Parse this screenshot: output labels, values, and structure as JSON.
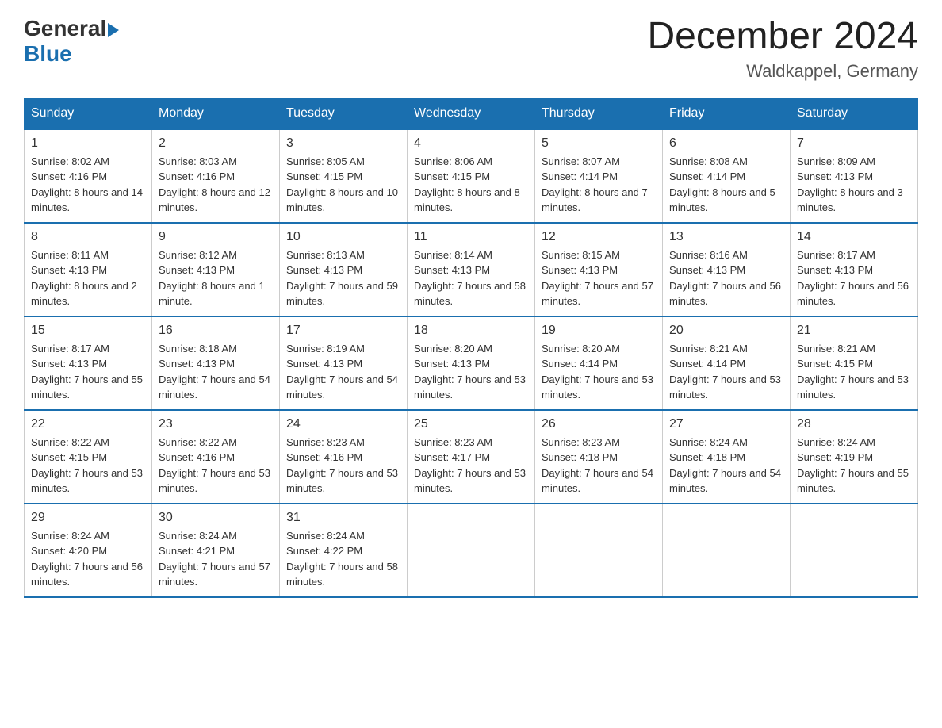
{
  "logo": {
    "general": "General",
    "blue": "Blue"
  },
  "header": {
    "month_title": "December 2024",
    "location": "Waldkappel, Germany"
  },
  "columns": [
    "Sunday",
    "Monday",
    "Tuesday",
    "Wednesday",
    "Thursday",
    "Friday",
    "Saturday"
  ],
  "weeks": [
    [
      {
        "day": "1",
        "sunrise": "8:02 AM",
        "sunset": "4:16 PM",
        "daylight": "8 hours and 14 minutes."
      },
      {
        "day": "2",
        "sunrise": "8:03 AM",
        "sunset": "4:16 PM",
        "daylight": "8 hours and 12 minutes."
      },
      {
        "day": "3",
        "sunrise": "8:05 AM",
        "sunset": "4:15 PM",
        "daylight": "8 hours and 10 minutes."
      },
      {
        "day": "4",
        "sunrise": "8:06 AM",
        "sunset": "4:15 PM",
        "daylight": "8 hours and 8 minutes."
      },
      {
        "day": "5",
        "sunrise": "8:07 AM",
        "sunset": "4:14 PM",
        "daylight": "8 hours and 7 minutes."
      },
      {
        "day": "6",
        "sunrise": "8:08 AM",
        "sunset": "4:14 PM",
        "daylight": "8 hours and 5 minutes."
      },
      {
        "day": "7",
        "sunrise": "8:09 AM",
        "sunset": "4:13 PM",
        "daylight": "8 hours and 3 minutes."
      }
    ],
    [
      {
        "day": "8",
        "sunrise": "8:11 AM",
        "sunset": "4:13 PM",
        "daylight": "8 hours and 2 minutes."
      },
      {
        "day": "9",
        "sunrise": "8:12 AM",
        "sunset": "4:13 PM",
        "daylight": "8 hours and 1 minute."
      },
      {
        "day": "10",
        "sunrise": "8:13 AM",
        "sunset": "4:13 PM",
        "daylight": "7 hours and 59 minutes."
      },
      {
        "day": "11",
        "sunrise": "8:14 AM",
        "sunset": "4:13 PM",
        "daylight": "7 hours and 58 minutes."
      },
      {
        "day": "12",
        "sunrise": "8:15 AM",
        "sunset": "4:13 PM",
        "daylight": "7 hours and 57 minutes."
      },
      {
        "day": "13",
        "sunrise": "8:16 AM",
        "sunset": "4:13 PM",
        "daylight": "7 hours and 56 minutes."
      },
      {
        "day": "14",
        "sunrise": "8:17 AM",
        "sunset": "4:13 PM",
        "daylight": "7 hours and 56 minutes."
      }
    ],
    [
      {
        "day": "15",
        "sunrise": "8:17 AM",
        "sunset": "4:13 PM",
        "daylight": "7 hours and 55 minutes."
      },
      {
        "day": "16",
        "sunrise": "8:18 AM",
        "sunset": "4:13 PM",
        "daylight": "7 hours and 54 minutes."
      },
      {
        "day": "17",
        "sunrise": "8:19 AM",
        "sunset": "4:13 PM",
        "daylight": "7 hours and 54 minutes."
      },
      {
        "day": "18",
        "sunrise": "8:20 AM",
        "sunset": "4:13 PM",
        "daylight": "7 hours and 53 minutes."
      },
      {
        "day": "19",
        "sunrise": "8:20 AM",
        "sunset": "4:14 PM",
        "daylight": "7 hours and 53 minutes."
      },
      {
        "day": "20",
        "sunrise": "8:21 AM",
        "sunset": "4:14 PM",
        "daylight": "7 hours and 53 minutes."
      },
      {
        "day": "21",
        "sunrise": "8:21 AM",
        "sunset": "4:15 PM",
        "daylight": "7 hours and 53 minutes."
      }
    ],
    [
      {
        "day": "22",
        "sunrise": "8:22 AM",
        "sunset": "4:15 PM",
        "daylight": "7 hours and 53 minutes."
      },
      {
        "day": "23",
        "sunrise": "8:22 AM",
        "sunset": "4:16 PM",
        "daylight": "7 hours and 53 minutes."
      },
      {
        "day": "24",
        "sunrise": "8:23 AM",
        "sunset": "4:16 PM",
        "daylight": "7 hours and 53 minutes."
      },
      {
        "day": "25",
        "sunrise": "8:23 AM",
        "sunset": "4:17 PM",
        "daylight": "7 hours and 53 minutes."
      },
      {
        "day": "26",
        "sunrise": "8:23 AM",
        "sunset": "4:18 PM",
        "daylight": "7 hours and 54 minutes."
      },
      {
        "day": "27",
        "sunrise": "8:24 AM",
        "sunset": "4:18 PM",
        "daylight": "7 hours and 54 minutes."
      },
      {
        "day": "28",
        "sunrise": "8:24 AM",
        "sunset": "4:19 PM",
        "daylight": "7 hours and 55 minutes."
      }
    ],
    [
      {
        "day": "29",
        "sunrise": "8:24 AM",
        "sunset": "4:20 PM",
        "daylight": "7 hours and 56 minutes."
      },
      {
        "day": "30",
        "sunrise": "8:24 AM",
        "sunset": "4:21 PM",
        "daylight": "7 hours and 57 minutes."
      },
      {
        "day": "31",
        "sunrise": "8:24 AM",
        "sunset": "4:22 PM",
        "daylight": "7 hours and 58 minutes."
      },
      null,
      null,
      null,
      null
    ]
  ]
}
